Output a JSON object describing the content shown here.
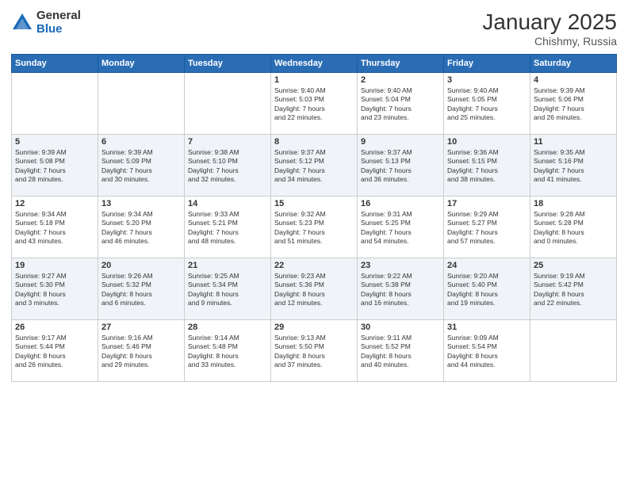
{
  "header": {
    "logo_general": "General",
    "logo_blue": "Blue",
    "month_title": "January 2025",
    "location": "Chishmy, Russia"
  },
  "days_of_week": [
    "Sunday",
    "Monday",
    "Tuesday",
    "Wednesday",
    "Thursday",
    "Friday",
    "Saturday"
  ],
  "weeks": [
    [
      {
        "day": "",
        "info": ""
      },
      {
        "day": "",
        "info": ""
      },
      {
        "day": "",
        "info": ""
      },
      {
        "day": "1",
        "info": "Sunrise: 9:40 AM\nSunset: 5:03 PM\nDaylight: 7 hours\nand 22 minutes."
      },
      {
        "day": "2",
        "info": "Sunrise: 9:40 AM\nSunset: 5:04 PM\nDaylight: 7 hours\nand 23 minutes."
      },
      {
        "day": "3",
        "info": "Sunrise: 9:40 AM\nSunset: 5:05 PM\nDaylight: 7 hours\nand 25 minutes."
      },
      {
        "day": "4",
        "info": "Sunrise: 9:39 AM\nSunset: 5:06 PM\nDaylight: 7 hours\nand 26 minutes."
      }
    ],
    [
      {
        "day": "5",
        "info": "Sunrise: 9:39 AM\nSunset: 5:08 PM\nDaylight: 7 hours\nand 28 minutes."
      },
      {
        "day": "6",
        "info": "Sunrise: 9:39 AM\nSunset: 5:09 PM\nDaylight: 7 hours\nand 30 minutes."
      },
      {
        "day": "7",
        "info": "Sunrise: 9:38 AM\nSunset: 5:10 PM\nDaylight: 7 hours\nand 32 minutes."
      },
      {
        "day": "8",
        "info": "Sunrise: 9:37 AM\nSunset: 5:12 PM\nDaylight: 7 hours\nand 34 minutes."
      },
      {
        "day": "9",
        "info": "Sunrise: 9:37 AM\nSunset: 5:13 PM\nDaylight: 7 hours\nand 36 minutes."
      },
      {
        "day": "10",
        "info": "Sunrise: 9:36 AM\nSunset: 5:15 PM\nDaylight: 7 hours\nand 38 minutes."
      },
      {
        "day": "11",
        "info": "Sunrise: 9:35 AM\nSunset: 5:16 PM\nDaylight: 7 hours\nand 41 minutes."
      }
    ],
    [
      {
        "day": "12",
        "info": "Sunrise: 9:34 AM\nSunset: 5:18 PM\nDaylight: 7 hours\nand 43 minutes."
      },
      {
        "day": "13",
        "info": "Sunrise: 9:34 AM\nSunset: 5:20 PM\nDaylight: 7 hours\nand 46 minutes."
      },
      {
        "day": "14",
        "info": "Sunrise: 9:33 AM\nSunset: 5:21 PM\nDaylight: 7 hours\nand 48 minutes."
      },
      {
        "day": "15",
        "info": "Sunrise: 9:32 AM\nSunset: 5:23 PM\nDaylight: 7 hours\nand 51 minutes."
      },
      {
        "day": "16",
        "info": "Sunrise: 9:31 AM\nSunset: 5:25 PM\nDaylight: 7 hours\nand 54 minutes."
      },
      {
        "day": "17",
        "info": "Sunrise: 9:29 AM\nSunset: 5:27 PM\nDaylight: 7 hours\nand 57 minutes."
      },
      {
        "day": "18",
        "info": "Sunrise: 9:28 AM\nSunset: 5:28 PM\nDaylight: 8 hours\nand 0 minutes."
      }
    ],
    [
      {
        "day": "19",
        "info": "Sunrise: 9:27 AM\nSunset: 5:30 PM\nDaylight: 8 hours\nand 3 minutes."
      },
      {
        "day": "20",
        "info": "Sunrise: 9:26 AM\nSunset: 5:32 PM\nDaylight: 8 hours\nand 6 minutes."
      },
      {
        "day": "21",
        "info": "Sunrise: 9:25 AM\nSunset: 5:34 PM\nDaylight: 8 hours\nand 9 minutes."
      },
      {
        "day": "22",
        "info": "Sunrise: 9:23 AM\nSunset: 5:36 PM\nDaylight: 8 hours\nand 12 minutes."
      },
      {
        "day": "23",
        "info": "Sunrise: 9:22 AM\nSunset: 5:38 PM\nDaylight: 8 hours\nand 16 minutes."
      },
      {
        "day": "24",
        "info": "Sunrise: 9:20 AM\nSunset: 5:40 PM\nDaylight: 8 hours\nand 19 minutes."
      },
      {
        "day": "25",
        "info": "Sunrise: 9:19 AM\nSunset: 5:42 PM\nDaylight: 8 hours\nand 22 minutes."
      }
    ],
    [
      {
        "day": "26",
        "info": "Sunrise: 9:17 AM\nSunset: 5:44 PM\nDaylight: 8 hours\nand 26 minutes."
      },
      {
        "day": "27",
        "info": "Sunrise: 9:16 AM\nSunset: 5:46 PM\nDaylight: 8 hours\nand 29 minutes."
      },
      {
        "day": "28",
        "info": "Sunrise: 9:14 AM\nSunset: 5:48 PM\nDaylight: 8 hours\nand 33 minutes."
      },
      {
        "day": "29",
        "info": "Sunrise: 9:13 AM\nSunset: 5:50 PM\nDaylight: 8 hours\nand 37 minutes."
      },
      {
        "day": "30",
        "info": "Sunrise: 9:11 AM\nSunset: 5:52 PM\nDaylight: 8 hours\nand 40 minutes."
      },
      {
        "day": "31",
        "info": "Sunrise: 9:09 AM\nSunset: 5:54 PM\nDaylight: 8 hours\nand 44 minutes."
      },
      {
        "day": "",
        "info": ""
      }
    ]
  ]
}
